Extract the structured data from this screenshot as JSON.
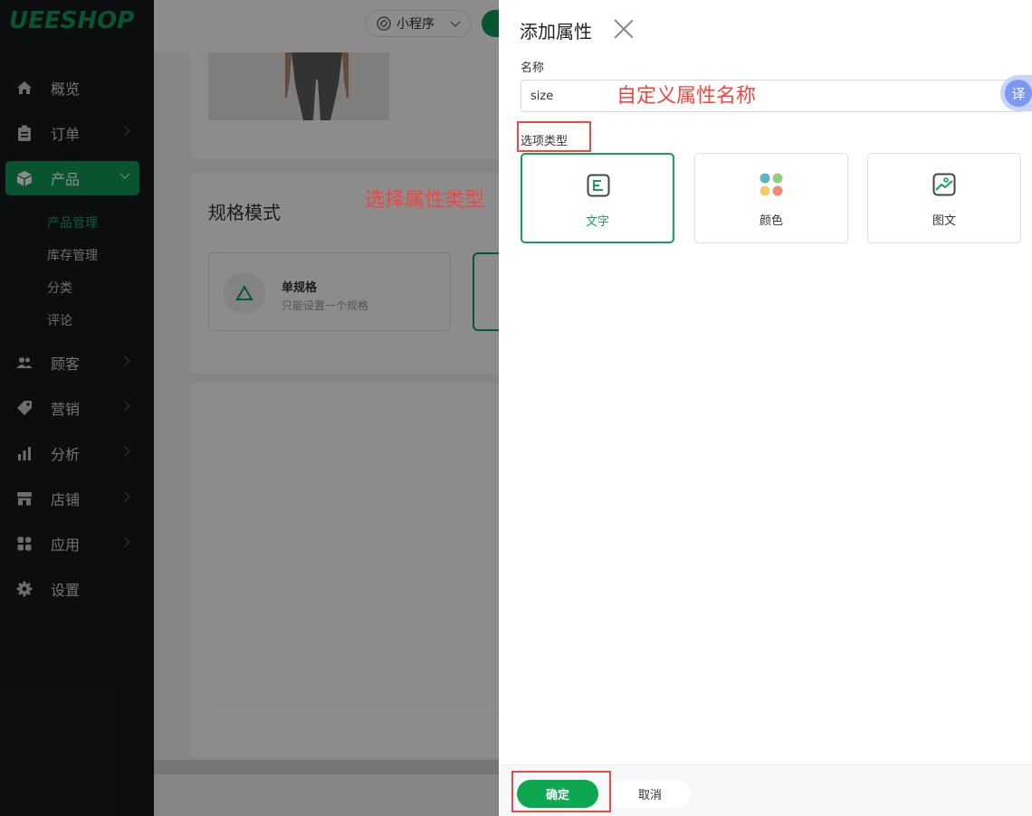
{
  "sidebar": {
    "logo": "UEESHOP",
    "items": [
      {
        "label": "概览",
        "icon": "home-icon"
      },
      {
        "label": "订单",
        "icon": "clipboard-icon"
      },
      {
        "label": "产品",
        "icon": "box-icon"
      },
      {
        "label": "顾客",
        "icon": "users-icon"
      },
      {
        "label": "营销",
        "icon": "tag-icon"
      },
      {
        "label": "分析",
        "icon": "bar-chart-icon"
      },
      {
        "label": "店铺",
        "icon": "store-icon"
      },
      {
        "label": "应用",
        "icon": "apps-icon"
      },
      {
        "label": "设置",
        "icon": "gear-icon"
      }
    ],
    "product_sub_items": [
      "产品管理",
      "库存管理",
      "分类",
      "评论"
    ]
  },
  "topbar": {
    "mini_program_label": "小程序"
  },
  "background": {
    "section_title": "规格模式",
    "single_spec": {
      "title": "单规格",
      "desc": "只能设置一个规格"
    }
  },
  "drawer": {
    "title": "添加属性",
    "name_label": "名称",
    "name_value": "size",
    "translate_label": "译",
    "type_label": "选项类型",
    "options": [
      {
        "label": "文字",
        "icon": "text-icon",
        "selected": true
      },
      {
        "label": "颜色",
        "icon": "color-dots-icon",
        "selected": false
      },
      {
        "label": "图文",
        "icon": "image-icon",
        "selected": false
      }
    ],
    "confirm_label": "确定",
    "cancel_label": "取消"
  },
  "annotations": {
    "name_hint": "自定义属性名称",
    "type_hint": "选择属性类型"
  },
  "colors": {
    "brand_green": "#0f9a55",
    "annotation_red": "#ec4a45",
    "sidebar_bg": "#17191c"
  }
}
